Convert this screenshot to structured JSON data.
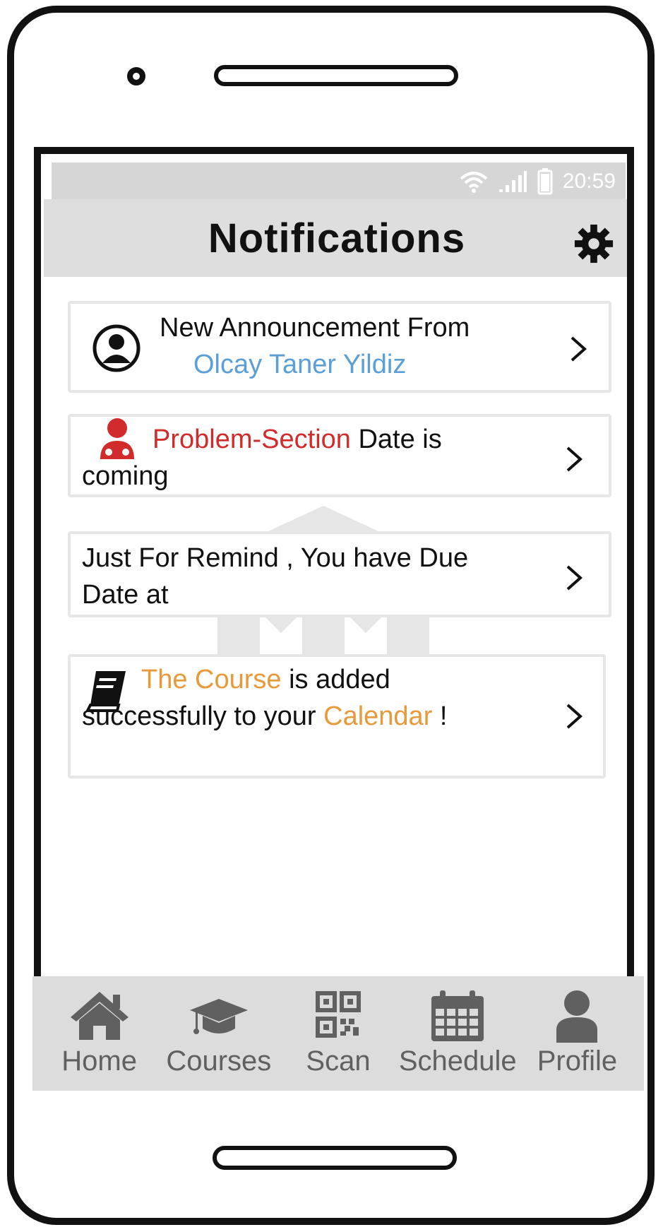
{
  "status_bar": {
    "time": "20:59"
  },
  "header": {
    "title": "Notifications"
  },
  "notifications": [
    {
      "prefix": "New Announcement From",
      "highlight": "Olcay Taner Yildiz"
    },
    {
      "highlight": "Problem-Section",
      "suffix": " Date is",
      "line2": "coming"
    },
    {
      "line1": "Just For Remind , You have Due",
      "line2": "Date at"
    },
    {
      "highlight1": "The Course",
      "mid1": " is added",
      "line2_prefix": "successfully to your ",
      "highlight2": "Calendar",
      "line2_suffix": " !"
    }
  ],
  "tabs": [
    {
      "label": "Home",
      "icon": "home-icon"
    },
    {
      "label": "Courses",
      "icon": "graduation-cap-icon"
    },
    {
      "label": "Scan",
      "icon": "qr-code-icon"
    },
    {
      "label": "Schedule",
      "icon": "calendar-icon"
    },
    {
      "label": "Profile",
      "icon": "person-icon"
    }
  ],
  "colors": {
    "link": "#5a9fd6",
    "alert": "#d12b2b",
    "accent": "#e89a3a",
    "tab_bar": "#dcdcdc",
    "header": "#dedede"
  }
}
